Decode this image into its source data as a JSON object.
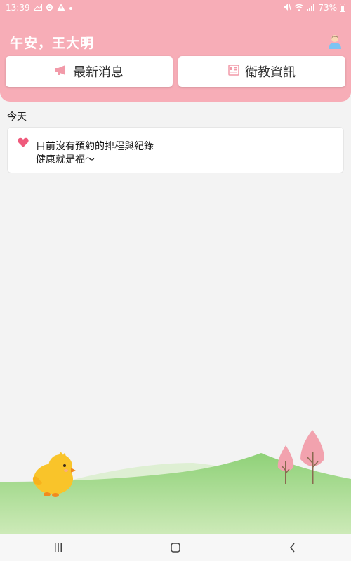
{
  "status_bar": {
    "time": "13:39",
    "left_icons": [
      "gallery-icon",
      "settings-icon",
      "warning-icon",
      "dot-icon"
    ],
    "right_icons": [
      "mute-icon",
      "wifi-icon",
      "signal-icon"
    ],
    "battery": "73%"
  },
  "header": {
    "greeting": "午安，王大明",
    "profile_icon": "person-icon"
  },
  "buttons": {
    "news": {
      "label": "最新消息",
      "icon": "megaphone-icon"
    },
    "health_edu": {
      "label": "衛教資訊",
      "icon": "document-icon"
    }
  },
  "today": {
    "title": "今天",
    "message_line1": "目前沒有預約的排程與紀錄",
    "message_line2": "健康就是福～",
    "icon": "heart-icon"
  },
  "nav": {
    "items": [
      "recent-apps-icon",
      "home-icon",
      "back-icon"
    ]
  },
  "colors": {
    "header_pink": "#f7adb7",
    "accent_heart": "#ef5a7c",
    "grass": "#8fd178",
    "background": "#f3f3f3"
  }
}
